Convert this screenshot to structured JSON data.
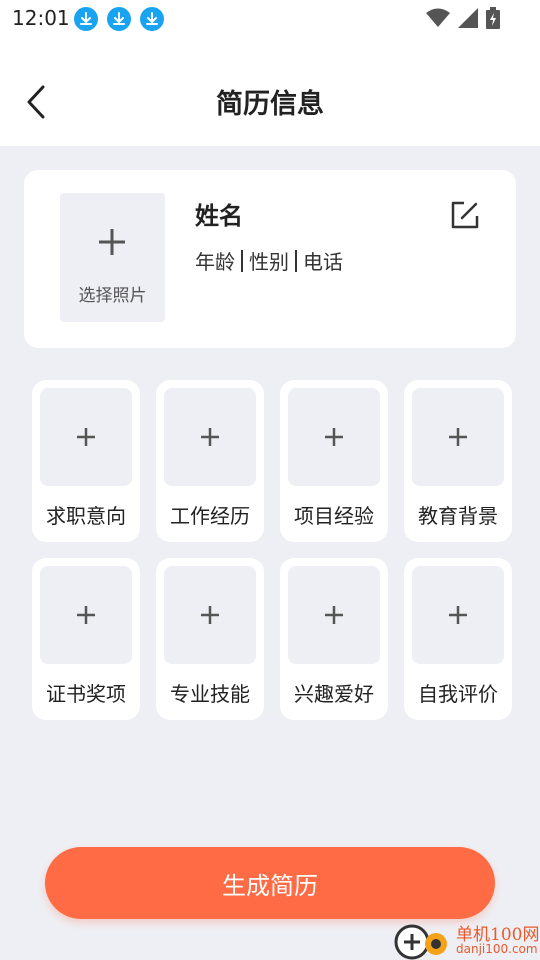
{
  "status_bar": {
    "time": "12:01",
    "download_icons": [
      "download-icon",
      "download-icon",
      "download-icon"
    ],
    "right_icons": [
      "wifi-icon",
      "signal-icon",
      "battery-icon"
    ]
  },
  "header": {
    "title": "简历信息",
    "back_icon": "chevron-left-icon"
  },
  "profile": {
    "photo_label": "选择照片",
    "name": "姓名",
    "age": "年龄",
    "gender": "性别",
    "phone": "电话",
    "edit_icon": "edit-icon"
  },
  "sections": [
    {
      "label": "求职意向"
    },
    {
      "label": "工作经历"
    },
    {
      "label": "项目经验"
    },
    {
      "label": "教育背景"
    },
    {
      "label": "证书奖项"
    },
    {
      "label": "专业技能"
    },
    {
      "label": "兴趣爱好"
    },
    {
      "label": "自我评价"
    }
  ],
  "generate_button": "生成简历",
  "watermark": {
    "line1": "单机100网",
    "line2": "danji100.com"
  },
  "colors": {
    "accent": "#ff6b45",
    "background": "#eeeff4",
    "card": "#ffffff",
    "download_badge": "#1aa3f0"
  }
}
